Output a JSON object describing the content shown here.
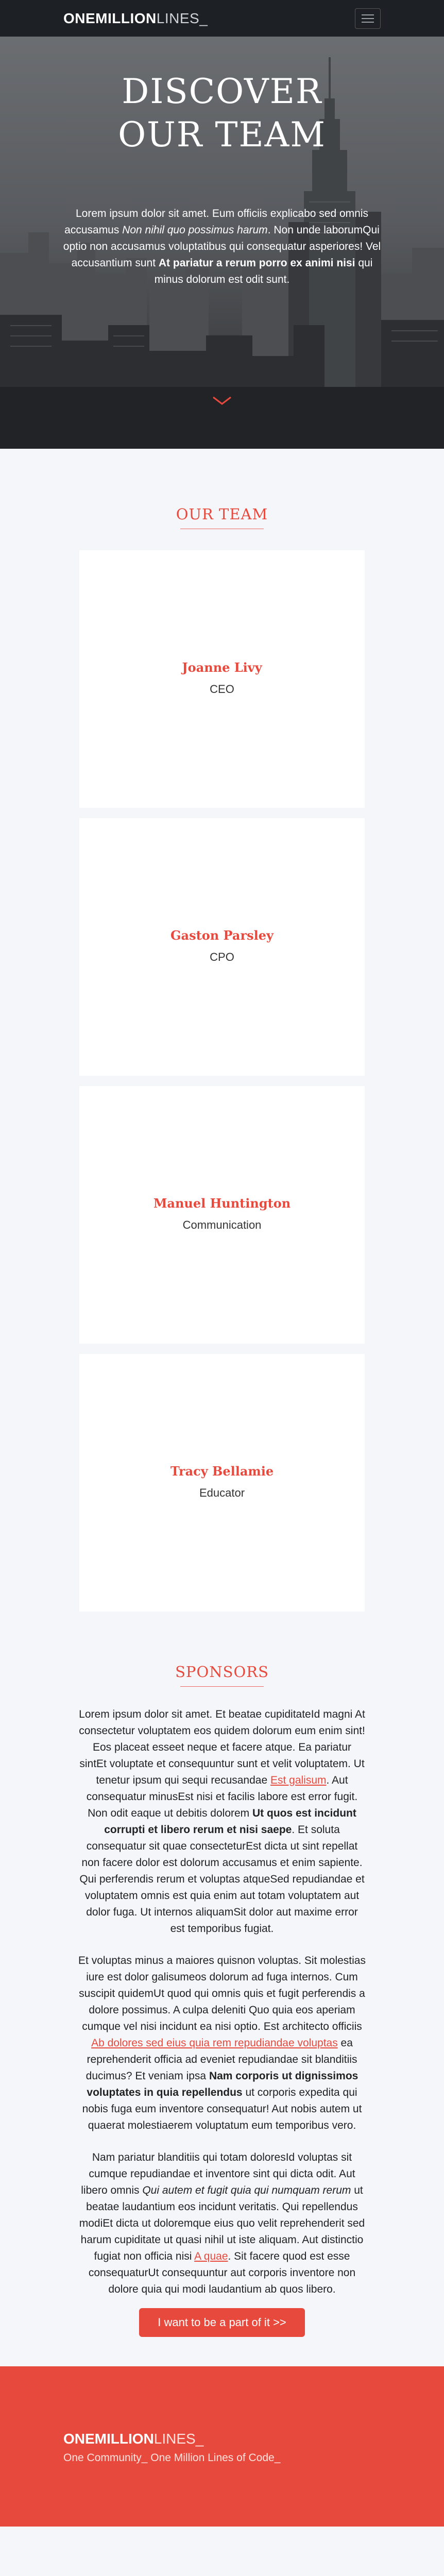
{
  "nav": {
    "logo_bold": "ONEMILLION",
    "logo_light": "LINES_",
    "menu_icon": "hamburger-menu-icon"
  },
  "hero": {
    "title_line1": "DISCOVER",
    "title_line2": "OUR TEAM",
    "text_1": "Lorem ipsum dolor sit amet. Eum officiis explicabo sed omnis accusamus ",
    "text_2": "Non nihil quo possimus harum",
    "text_3": ". Non unde laborumQui optio non accusamus voluptatibus qui consequatur asperiores! Vel accusantium sunt ",
    "text_4": "At pariatur a rerum porro ex animi nisi",
    "text_5": " qui minus dolorum est odit sunt.",
    "scroll_icon": "chevron-down-icon"
  },
  "team": {
    "title": "OUR TEAM",
    "members": [
      {
        "name": "Joanne Livy",
        "role": "CEO"
      },
      {
        "name": "Gaston Parsley",
        "role": "CPO"
      },
      {
        "name": "Manuel Huntington",
        "role": "Communication"
      },
      {
        "name": "Tracy Bellamie",
        "role": "Educator"
      }
    ]
  },
  "sponsors": {
    "title": "SPONSORS",
    "p1_a": "Lorem ipsum dolor sit amet. Et beatae cupiditateId magni At consectetur voluptatem eos quidem dolorum eum enim sint! Eos placeat esseet neque et facere atque. Ea pariatur sintEt voluptate et consequuntur sunt et velit voluptatem. Ut tenetur ipsum qui sequi recusandae ",
    "p1_link": "Est galisum",
    "p1_b": ". Aut consequatur minusEst nisi et facilis labore est error fugit. Non odit eaque ut debitis dolorem ",
    "p1_bold": "Ut quos est incidunt corrupti et libero rerum et nisi saepe",
    "p1_c": ". Et soluta consequatur sit quae consecteturEst dicta ut sint repellat non facere dolor est dolorum accusamus et enim sapiente. Qui perferendis rerum et voluptas atqueSed repudiandae et voluptatem omnis est quia enim aut totam voluptatem aut dolor fuga. Ut internos aliquamSit dolor aut maxime error est temporibus fugiat.",
    "p2_a": "Et voluptas minus a maiores quisnon voluptas. Sit molestias iure est dolor galisumeos dolorum ad fuga internos. Cum suscipit quidemUt quod qui omnis quis et fugit perferendis a dolore possimus. A culpa deleniti Quo quia eos aperiam cumque vel nisi incidunt ea nisi optio. Est architecto officiis ",
    "p2_link": "Ab dolores sed eius quia rem repudiandae voluptas",
    "p2_b": " ea reprehenderit officia ad eveniet repudiandae sit blanditiis ducimus? Et veniam ipsa ",
    "p2_bold": "Nam corporis ut dignissimos voluptates in quia repellendus",
    "p2_c": " ut corporis expedita qui nobis fuga eum inventore consequatur! Aut nobis autem ut quaerat molestiaerem voluptatum eum temporibus vero.",
    "p3_a": "Nam pariatur blanditiis qui totam doloresId voluptas sit cumque repudiandae et inventore sint qui dicta odit. Aut libero omnis ",
    "p3_italic": "Qui autem et fugit quia qui numquam rerum",
    "p3_b": " ut beatae laudantium eos incidunt veritatis. Qui repellendus modiEt dicta ut doloremque eius quo velit reprehenderit sed harum cupiditate ut quasi nihil ut iste aliquam. Aut distinctio fugiat non officia nisi ",
    "p3_link": "A quae",
    "p3_c": ". Sit facere quod est esse consequaturUt consequuntur aut corporis inventore non dolore quia qui modi laudantium ab quos libero.",
    "cta_label": "I want to be a part of it >>"
  },
  "footer": {
    "logo_bold": "ONEMILLION",
    "logo_light": "LINES_",
    "tagline": "One Community_ One Million Lines of Code_"
  },
  "colors": {
    "accent": "#e8493d",
    "nav_bg": "#1d2125",
    "page_bg": "#f4f6f9"
  }
}
